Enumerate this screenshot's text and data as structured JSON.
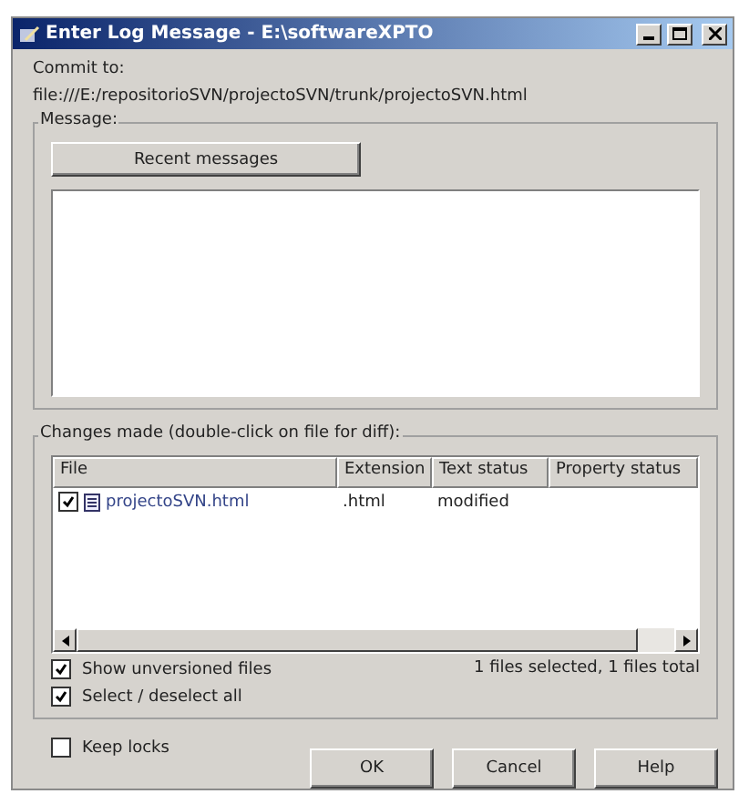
{
  "window": {
    "title": "Enter Log Message - E:\\softwareXPTO"
  },
  "commit_to": {
    "label": "Commit to:",
    "url": "file:///E:/repositorioSVN/projectoSVN/trunk/projectoSVN.html"
  },
  "message": {
    "legend": "Message:",
    "recent_button": "Recent messages"
  },
  "changes": {
    "legend": "Changes made (double-click on file for diff):",
    "columns": [
      "File",
      "Extension",
      "Text status",
      "Property status"
    ],
    "rows": [
      {
        "checked": true,
        "file": "projectoSVN.html",
        "extension": ".html",
        "text_status": "modified"
      }
    ],
    "options": [
      {
        "label": "Show unversioned files",
        "checked": true
      },
      {
        "label": "Select / deselect all",
        "checked": true
      }
    ],
    "summary": "1 files selected, 1 files total"
  },
  "keep_locks": {
    "label": "Keep locks",
    "checked": false
  },
  "buttons": [
    "OK",
    "Cancel",
    "Help"
  ]
}
